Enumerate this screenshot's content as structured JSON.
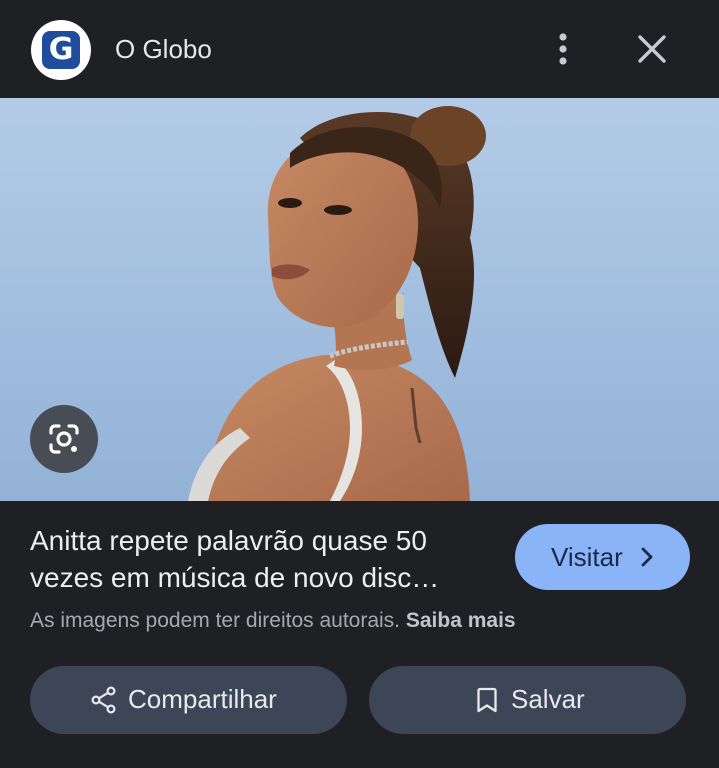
{
  "header": {
    "logo_letter": "G",
    "site_name": "O Globo",
    "more_icon": "more-vertical-icon",
    "close_icon": "close-icon"
  },
  "image": {
    "lens_icon": "google-lens-icon"
  },
  "result": {
    "title_line1": "Anitta repete palavrão quase 50",
    "title_line2": "vezes em música de novo disc…",
    "visit_label": "Visitar",
    "copyright_text": "As imagens podem ter direitos autorais.",
    "learn_more": "Saiba mais"
  },
  "actions": {
    "share_label": "Compartilhar",
    "share_icon": "share-icon",
    "save_label": "Salvar",
    "save_icon": "bookmark-icon"
  },
  "colors": {
    "background": "#1f2024",
    "visit_button": "#8ab4f8",
    "action_pill": "#3d4656",
    "logo_blue": "#1f4d9c"
  }
}
